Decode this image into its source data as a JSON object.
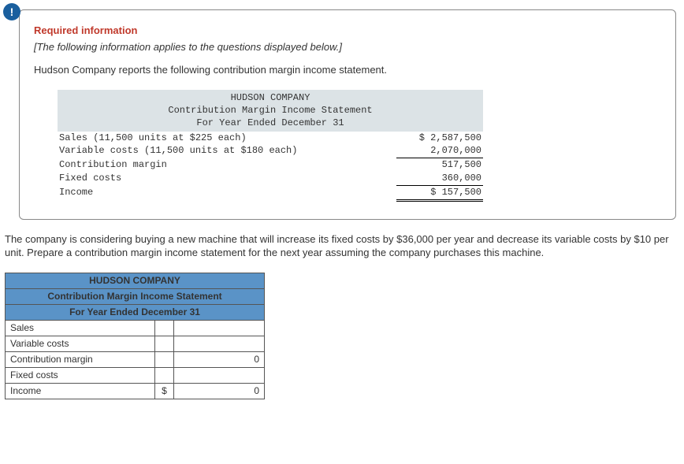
{
  "badge": "!",
  "info": {
    "required_label": "Required information",
    "note": "[The following information applies to the questions displayed below.]",
    "intro": "Hudson Company reports the following contribution margin income statement.",
    "stmt_header": {
      "l1": "HUDSON COMPANY",
      "l2": "Contribution Margin Income Statement",
      "l3": "For Year Ended December 31"
    },
    "rows": [
      {
        "label": "Sales (11,500 units at $225 each)",
        "value": "$ 2,587,500"
      },
      {
        "label": "Variable costs (11,500 units at $180 each)",
        "value": "2,070,000"
      },
      {
        "label": "Contribution margin",
        "value": "517,500"
      },
      {
        "label": "Fixed costs",
        "value": "360,000"
      },
      {
        "label": "Income",
        "value": "$ 157,500"
      }
    ]
  },
  "question": "The company is considering buying a new machine that will increase its fixed costs by $36,000 per year and decrease its variable costs by $10 per unit. Prepare a contribution margin income statement for the next year assuming the company purchases this machine.",
  "answer": {
    "header": {
      "l1": "HUDSON COMPANY",
      "l2": "Contribution Margin Income Statement",
      "l3": "For Year Ended December 31"
    },
    "rows": [
      {
        "label": "Sales",
        "sym": "",
        "value": ""
      },
      {
        "label": "Variable costs",
        "sym": "",
        "value": ""
      },
      {
        "label": "Contribution margin",
        "sym": "",
        "value": "0"
      },
      {
        "label": "Fixed costs",
        "sym": "",
        "value": ""
      },
      {
        "label": "Income",
        "sym": "$",
        "value": "0"
      }
    ]
  }
}
